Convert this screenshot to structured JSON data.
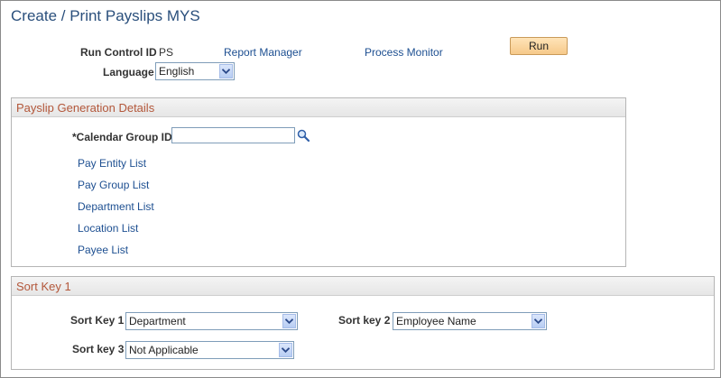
{
  "page": {
    "title": "Create / Print Payslips MYS"
  },
  "header": {
    "run_control_label": "Run Control ID",
    "run_control_value": "PS",
    "report_manager": "Report Manager",
    "process_monitor": "Process Monitor",
    "run_button": "Run",
    "language_label": "Language",
    "language_value": "English"
  },
  "payslip": {
    "title": "Payslip Generation Details",
    "calendar_label": "*Calendar Group ID",
    "calendar_value": "",
    "links": [
      "Pay Entity List",
      "Pay Group List",
      "Department List",
      "Location List",
      "Payee List"
    ]
  },
  "sortkeys": {
    "title": "Sort Key 1",
    "key1_label": "Sort Key 1",
    "key1_value": "Department",
    "key2_label": "Sort key 2",
    "key2_value": "Employee Name",
    "key3_label": "Sort key 3",
    "key3_value": "Not Applicable"
  },
  "colors": {
    "title": "#2a4f7c",
    "link": "#1d4f91",
    "section_title": "#b3573a",
    "button": "#f6c98a"
  },
  "icons": {
    "lookup": "magnifier-icon",
    "dropdown": "chevron-down-icon"
  }
}
